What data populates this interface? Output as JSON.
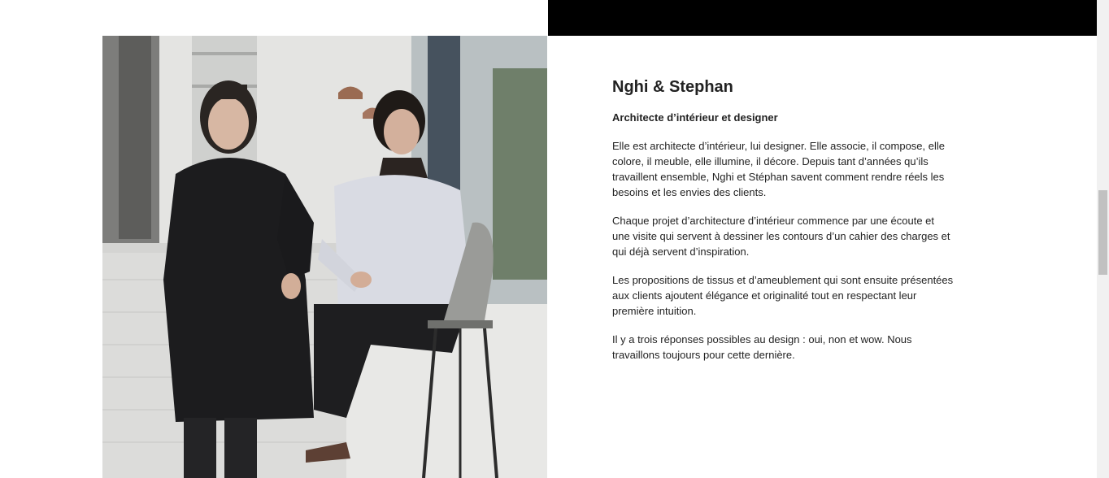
{
  "profile": {
    "name": "Nghi & Stephan",
    "role": "Architecte d’intérieur et designer",
    "paragraphs": [
      "Elle est architecte d’intérieur, lui designer. Elle associe, il compose, elle colore, il meuble, elle illumine, il décore. Depuis tant d’années qu’ils travaillent ensemble, Nghi et Stéphan savent comment rendre réels les besoins et les envies des clients.",
      "Chaque projet d’architecture d’intérieur commence par une écoute et une visite qui servent à dessiner les contours d’un cahier des charges et qui déjà servent d’inspiration.",
      "Les propositions de tissus et d’ameublement qui sont ensuite présentées aux clients ajoutent élégance et originalité tout en respectant leur première intuition.",
      "Il y a trois réponses possibles au design : oui, non et wow. Nous travaillons toujours pour cette dernière."
    ]
  },
  "colors": {
    "band": "#000000",
    "text": "#222222",
    "background": "#ffffff"
  }
}
